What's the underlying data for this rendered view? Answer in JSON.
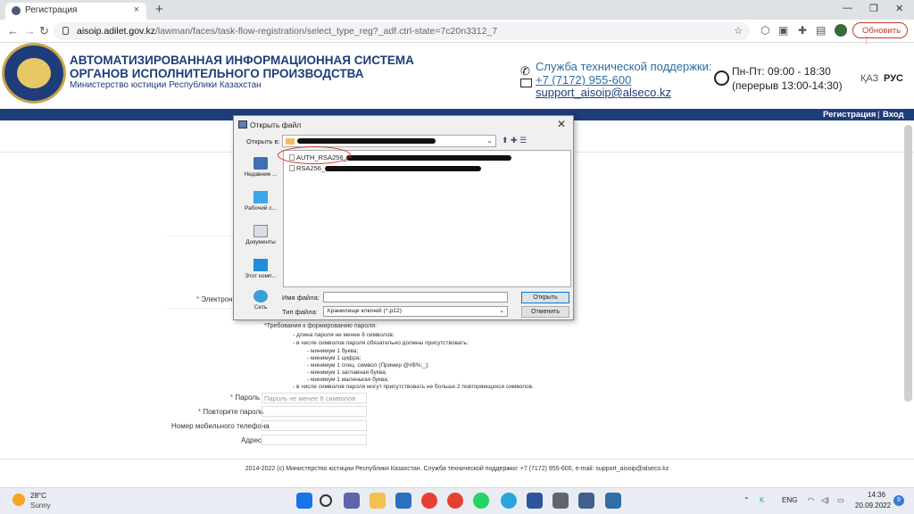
{
  "browser": {
    "tab_title": "Регистрация",
    "tab_close": "×",
    "new_tab": "+",
    "win_min": "—",
    "win_max": "❐",
    "win_close": "✕",
    "url_host": "aisoip.adilet.gov.kz",
    "url_path": "/lawman/faces/task-flow-registration/select_type_reg?_adf.ctrl-state=7c20n3312_7",
    "update_label": "Обновить"
  },
  "site": {
    "title_line1": "АВТОМАТИЗИРОВАННАЯ ИНФОРМАЦИОННАЯ СИСТЕМА",
    "title_line2": "ОРГАНОВ ИСПОЛНИТЕЛЬНОГО ПРОИЗВОДСТВА",
    "subtitle": "Министерство юстиции Республики Казахстан",
    "support_label": "Служба технической поддержки:",
    "phone": "+7 (7172) 955-600",
    "email": "support_aisoip@alseco.kz",
    "hours": "Пн-Пт: 09:00 - 18:30",
    "break": "(перерыв 13:00-14:30)",
    "lang_kz": "ҚАЗ",
    "lang_ru": "РУС",
    "nav_register": "Регистрация",
    "nav_separator": "|",
    "nav_login": "Вход"
  },
  "form": {
    "email_label": "Электрон",
    "requirements_title": "*Требования к формированию пароля:",
    "requirements": [
      "- длина пароля не менее 8 символов;",
      "- в числе символов пароля обязательно должны присутствовать:",
      "- минимум 1 буква;",
      "- минимум 1 цифра;",
      "- минимум 1 спец. символ (Пример @#$%;_);",
      "- минимум 1 заглавная буква;",
      "- минимум 1 маленькая буква;",
      "- в числе символов пароля могут присутствовать не больше 2 повторяющихся символов."
    ],
    "required_mark": "*",
    "password_label": "Пароль",
    "password_placeholder": "Пароль не менее 8 символов",
    "repeat_label": "Повторите пароль",
    "mobile_label": "Номер мобильного телефона",
    "address_label": "Адрес"
  },
  "footer": {
    "text": "2014-2022 (с) Министерство юстиции Республики Казахстан. Служба технической поддержки: +7 (7172) 955-600, e-mail: support_aisoip@alseco.kz"
  },
  "dialog": {
    "title": "Открыть файл",
    "close": "✕",
    "look_in_label": "Открыть в:",
    "places": [
      {
        "label": "Недавние ..."
      },
      {
        "label": "Рабочий с..."
      },
      {
        "label": "Документы"
      },
      {
        "label": "Этот комп..."
      },
      {
        "label": "Сеть"
      }
    ],
    "files": [
      {
        "name": "AUTH_RSA256_"
      },
      {
        "name": "RSA256_"
      }
    ],
    "filename_label": "Имя файла:",
    "filetype_label": "Тип файла:",
    "filetype_value": "Хранилище ключей (*.p12)",
    "open_button": "Открыть",
    "cancel_button": "Отменить"
  },
  "taskbar": {
    "temperature": "28°C",
    "condition": "Sunny",
    "language": "ENG",
    "time": "14:36",
    "date": "20.09.2022",
    "notifications": "9"
  },
  "colors": {
    "brand_blue": "#1e3d7a",
    "annotation_red": "#d0312d",
    "link_blue": "#2e6da4"
  }
}
